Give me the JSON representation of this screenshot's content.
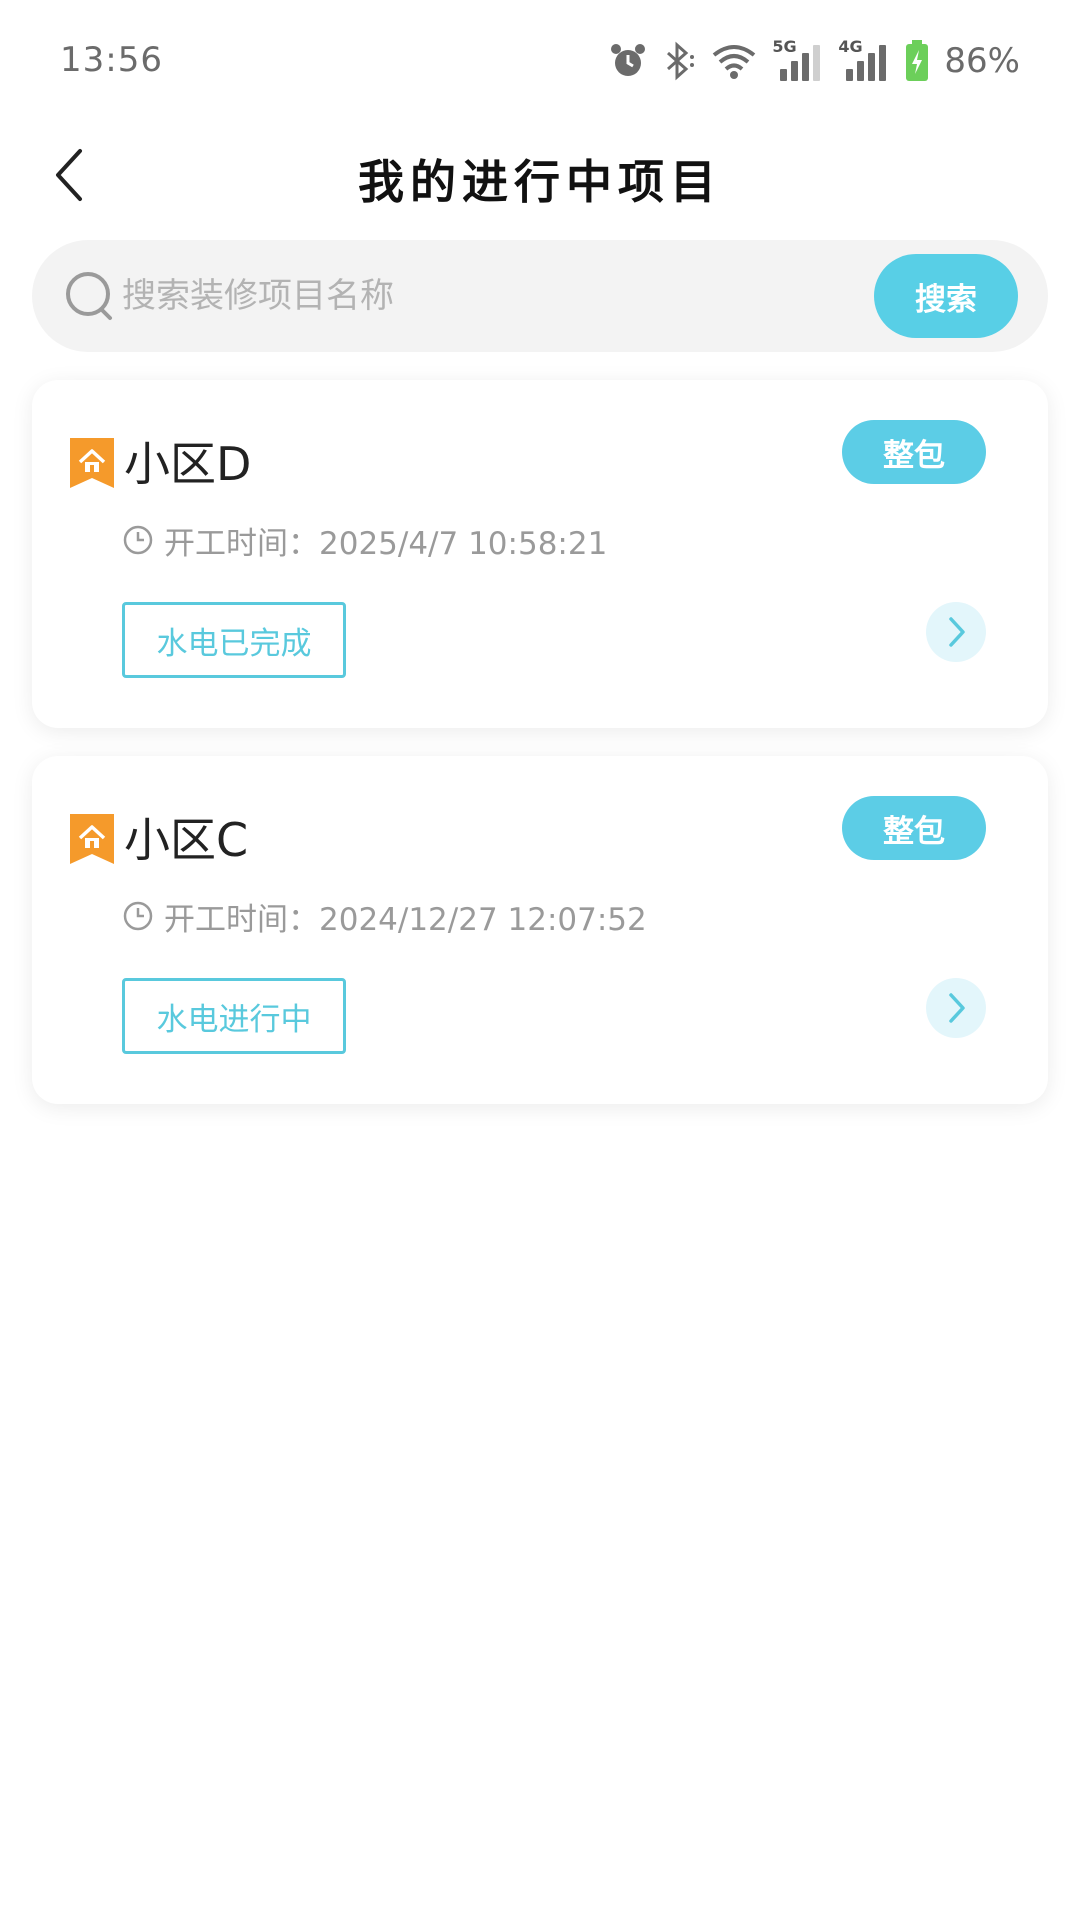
{
  "status_bar": {
    "time": "13:56",
    "battery": "86%",
    "net1": "5G",
    "net2": "4G"
  },
  "header": {
    "title": "我的进行中项目"
  },
  "search": {
    "placeholder": "搜索装修项目名称",
    "value": "",
    "button_label": "搜索"
  },
  "projects": [
    {
      "name": "小区D",
      "tag": "整包",
      "start_label": "开工时间：",
      "start_time": "2025/4/7 10:58:21",
      "status": "水电已完成"
    },
    {
      "name": "小区C",
      "tag": "整包",
      "start_label": "开工时间：",
      "start_time": "2024/12/27 12:07:52",
      "status": "水电进行中"
    }
  ],
  "colors": {
    "accent": "#5ccde6",
    "status_border": "#59c9dd",
    "house_icon": "#f59a2b"
  }
}
